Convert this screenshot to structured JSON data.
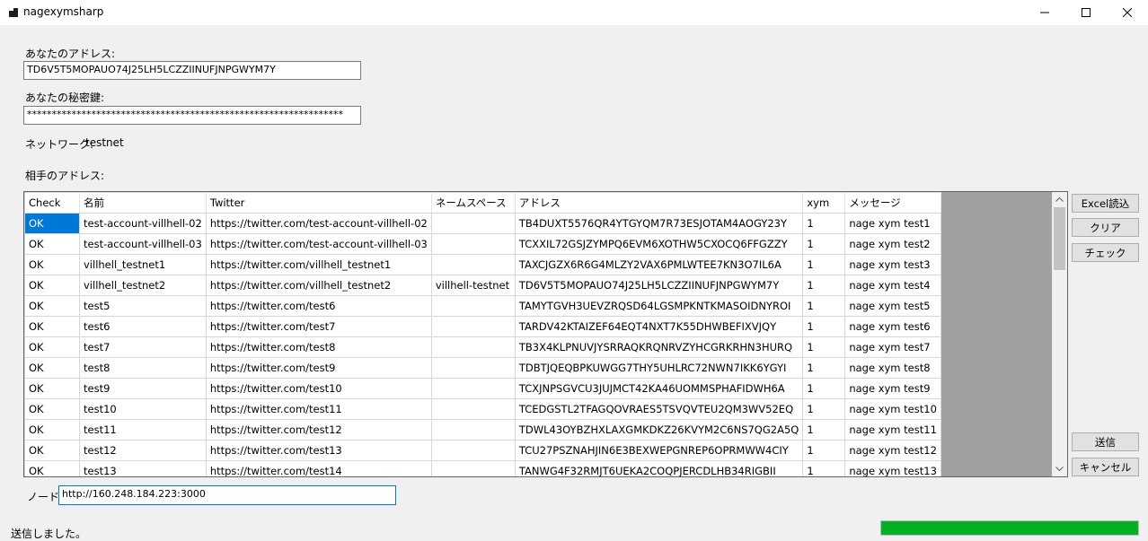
{
  "window": {
    "title": "nagexymsharp",
    "icon": "app-window-icon"
  },
  "form": {
    "address_label": "あなたのアドレス:",
    "address_value": "TD6V5T5MOPAUO74J25LH5LCZZIINUFJNPGWYM7Y",
    "secret_label": "あなたの秘密鍵:",
    "secret_value": "****************************************************************",
    "network_label": "ネットワーク:",
    "network_value": "testnet",
    "recipients_label": "相手のアドレス:",
    "node_label": "ノード:",
    "node_value": "http://160.248.184.223:3000"
  },
  "grid": {
    "columns": [
      "Check",
      "名前",
      "Twitter",
      "ネームスペース",
      "アドレス",
      "xym",
      "メッセージ"
    ],
    "rows": [
      [
        "OK",
        "test-account-villhell-02",
        "https://twitter.com/test-account-villhell-02",
        "",
        "TB4DUXT5576QR4YTGYQM7R73ESJOTAM4AOGY23Y",
        "1",
        "nage xym test1"
      ],
      [
        "OK",
        "test-account-villhell-03",
        "https://twitter.com/test-account-villhell-03",
        "",
        "TCXXIL72GSJZYMPQ6EVM6XOTHW5CXOCQ6FFGZZY",
        "1",
        "nage xym test2"
      ],
      [
        "OK",
        "villhell_testnet1",
        "https://twitter.com/villhell_testnet1",
        "",
        "TAXCJGZX6R6G4MLZY2VAX6PMLWTEE7KN3O7IL6A",
        "1",
        "nage xym test3"
      ],
      [
        "OK",
        "villhell_testnet2",
        "https://twitter.com/villhell_testnet2",
        "villhell-testnet",
        "TD6V5T5MOPAUO74J25LH5LCZZIINUFJNPGWYM7Y",
        "1",
        "nage xym test4"
      ],
      [
        "OK",
        "test5",
        "https://twitter.com/test6",
        "",
        "TAMYTGVH3UEVZRQSD64LGSMPKNTKMASOIDNYROI",
        "1",
        "nage xym test5"
      ],
      [
        "OK",
        "test6",
        "https://twitter.com/test7",
        "",
        "TARDV42KTAIZEF64EQT4NXT7K55DHWBEFIXVJQY",
        "1",
        "nage xym test6"
      ],
      [
        "OK",
        "test7",
        "https://twitter.com/test8",
        "",
        "TB3X4KLPNUVJYSRRAQKRQNRVZYHCGRKRHN3HURQ",
        "1",
        "nage xym test7"
      ],
      [
        "OK",
        "test8",
        "https://twitter.com/test9",
        "",
        "TDBTJQEQBPKUWGG7THY5UHLRC72NWN7IKK6YGYI",
        "1",
        "nage xym test8"
      ],
      [
        "OK",
        "test9",
        "https://twitter.com/test10",
        "",
        "TCXJNPSGVCU3JUJMCT42KA46UOMMSPHAFIDWH6A",
        "1",
        "nage xym test9"
      ],
      [
        "OK",
        "test10",
        "https://twitter.com/test11",
        "",
        "TCEDGSTL2TFAGQOVRAES5TSVQVTEU2QM3WV52EQ",
        "1",
        "nage xym test10"
      ],
      [
        "OK",
        "test11",
        "https://twitter.com/test12",
        "",
        "TDWL43OYBZHXLAXGMKDKZ26KVYM2C6NS7QG2A5Q",
        "1",
        "nage xym test11"
      ],
      [
        "OK",
        "test12",
        "https://twitter.com/test13",
        "",
        "TCU27PSZNAHJIN6E3BEXWEPGNREP6OPRMWW4CIY",
        "1",
        "nage xym test12"
      ],
      [
        "OK",
        "test13",
        "https://twitter.com/test14",
        "",
        "TANWG4F32RMJT6UEKA2COQPJERCDLHB34RIGBII",
        "1",
        "nage xym test13"
      ]
    ]
  },
  "buttons": {
    "excel": "Excel読込",
    "clear": "クリア",
    "check": "チェック",
    "send": "送信",
    "cancel": "キャンセル"
  },
  "status": {
    "message": "送信しました。",
    "progress": 1.0,
    "progress_color": "#06b025"
  },
  "colors": {
    "selection": "#0078d7",
    "grid_background": "#a0a0a0"
  }
}
